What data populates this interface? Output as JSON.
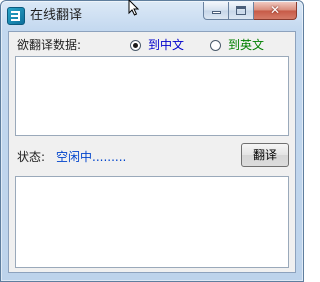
{
  "window": {
    "title": "在线翻译"
  },
  "source": {
    "label": "欲翻译数据:",
    "options": [
      {
        "label": "到中文",
        "selected": true,
        "color": "#0000cc"
      },
      {
        "label": "到英文",
        "selected": false,
        "color": "#008000"
      }
    ],
    "text": ""
  },
  "status": {
    "label": "状态:",
    "value": "空闲中.........",
    "button_label": "翻译"
  },
  "result": {
    "text": ""
  },
  "colors": {
    "status_value": "#0044cc"
  }
}
